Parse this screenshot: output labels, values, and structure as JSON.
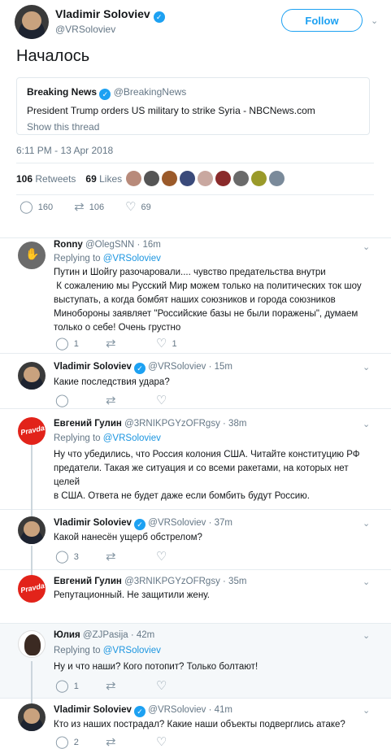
{
  "tweet": {
    "name": "Vladimir Soloviev",
    "handle": "@VRSoloviev",
    "follow_label": "Follow",
    "text": "Началось",
    "timestamp": "6:11 PM - 13 Apr 2018",
    "retweets_count": "106",
    "retweets_label": "Retweets",
    "likes_count": "69",
    "likes_label": "Likes",
    "actions": {
      "replies": "160",
      "retweets": "106",
      "likes": "69"
    }
  },
  "quote": {
    "name": "Breaking News",
    "handle": "@BreakingNews",
    "text": "President Trump orders US military to strike Syria - NBCNews.com",
    "thread_link": "Show this thread"
  },
  "replies": [
    {
      "name": "Ronny",
      "handle": "@OlegSNN",
      "time": "· 16m",
      "replying_prefix": "Replying to",
      "replying_to": "@VRSoloviev",
      "text_lines": [
        "Путин и Шойгу разочаровали.... чувство предательства внутри",
        " К сожалению мы Русский Мир можем только на политических ток шоу",
        "выступать, а когда бомбят наших союзников и города союзников",
        "Минобороны заявляет  \"Российские базы не были поражены\", думаем",
        "только о себе! Очень грустно"
      ],
      "reply_count": "1",
      "retweet_count": "",
      "like_count": "1"
    },
    {
      "name": "Vladimir Soloviev",
      "handle": "@VRSoloviev",
      "time": "· 15m",
      "text_lines": [
        "Какие последствия удара?"
      ],
      "reply_count": "",
      "retweet_count": "",
      "like_count": ""
    },
    {
      "name": "Евгений Гулин",
      "handle": "@3RNIKPGYzOFRgsy",
      "time": "· 38m",
      "replying_prefix": "Replying to",
      "replying_to": "@VRSoloviev",
      "text_lines": [
        "Ну что убедились, что Россия колония США. Читайте конституцию РФ",
        "предатели. Такая же ситуация и со всеми ракетами, на которых нет целей",
        "в США. Ответа не будет даже если бомбить будут Россию."
      ],
      "reply_count": "",
      "retweet_count": "",
      "like_count": ""
    },
    {
      "name": "Vladimir Soloviev",
      "handle": "@VRSoloviev",
      "time": "· 37m",
      "text_lines": [
        "Какой нанесён ущерб обстрелом?"
      ],
      "reply_count": "3",
      "retweet_count": "",
      "like_count": ""
    },
    {
      "name": "Евгений Гулин",
      "handle": "@3RNIKPGYzOFRgsy",
      "time": "· 35m",
      "text_lines": [
        "Репутационный. Не защитили жену."
      ],
      "reply_count": "",
      "retweet_count": "",
      "like_count": ""
    },
    {
      "name": "Юлия",
      "handle": "@ZJPasija",
      "time": "· 42m",
      "replying_prefix": "Replying to",
      "replying_to": "@VRSoloviev",
      "text_lines": [
        "Ну и что наши? Кого потопит?  Только болтают!"
      ],
      "reply_count": "1",
      "retweet_count": "",
      "like_count": ""
    },
    {
      "name": "Vladimir Soloviev",
      "handle": "@VRSoloviev",
      "time": "· 41m",
      "text_lines": [
        "Кто из наших пострадал? Какие наши объекты подверглись атаке?"
      ],
      "reply_count": "2",
      "retweet_count": "",
      "like_count": ""
    }
  ],
  "icons": {
    "reply": "reply-icon",
    "retweet": "retweet-icon",
    "like": "heart-icon",
    "chevron": "chevron-down-icon",
    "verified": "verified-badge-icon"
  },
  "colors": {
    "accent": "#1da1f2",
    "link": "#1b95e0",
    "muted": "#657786",
    "pravda_red": "#e2231a"
  }
}
